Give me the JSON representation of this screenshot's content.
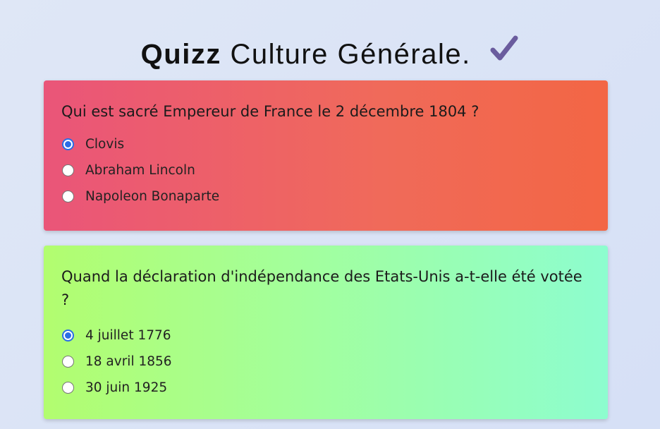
{
  "header": {
    "title_bold": "Quizz",
    "title_rest": "Culture Générale.",
    "icon": "checkmark-icon",
    "icon_color": "#6a5c9e"
  },
  "questions": [
    {
      "text": "Qui est sacré Empereur de France le 2 décembre 1804 ?",
      "options": [
        "Clovis",
        "Abraham Lincoln",
        "Napoleon Bonaparte"
      ],
      "selected_index": 0,
      "gradient": [
        "#ea5579",
        "#f36644"
      ]
    },
    {
      "text": "Quand la déclaration d'indépendance des Etats-Unis a-t-elle été votée ?",
      "options": [
        "4 juillet 1776",
        "18 avril 1856",
        "30 juin 1925"
      ],
      "selected_index": 0,
      "gradient": [
        "#b2fd6f",
        "#8dfdcf"
      ]
    }
  ],
  "accent_color": "#2b6de5"
}
